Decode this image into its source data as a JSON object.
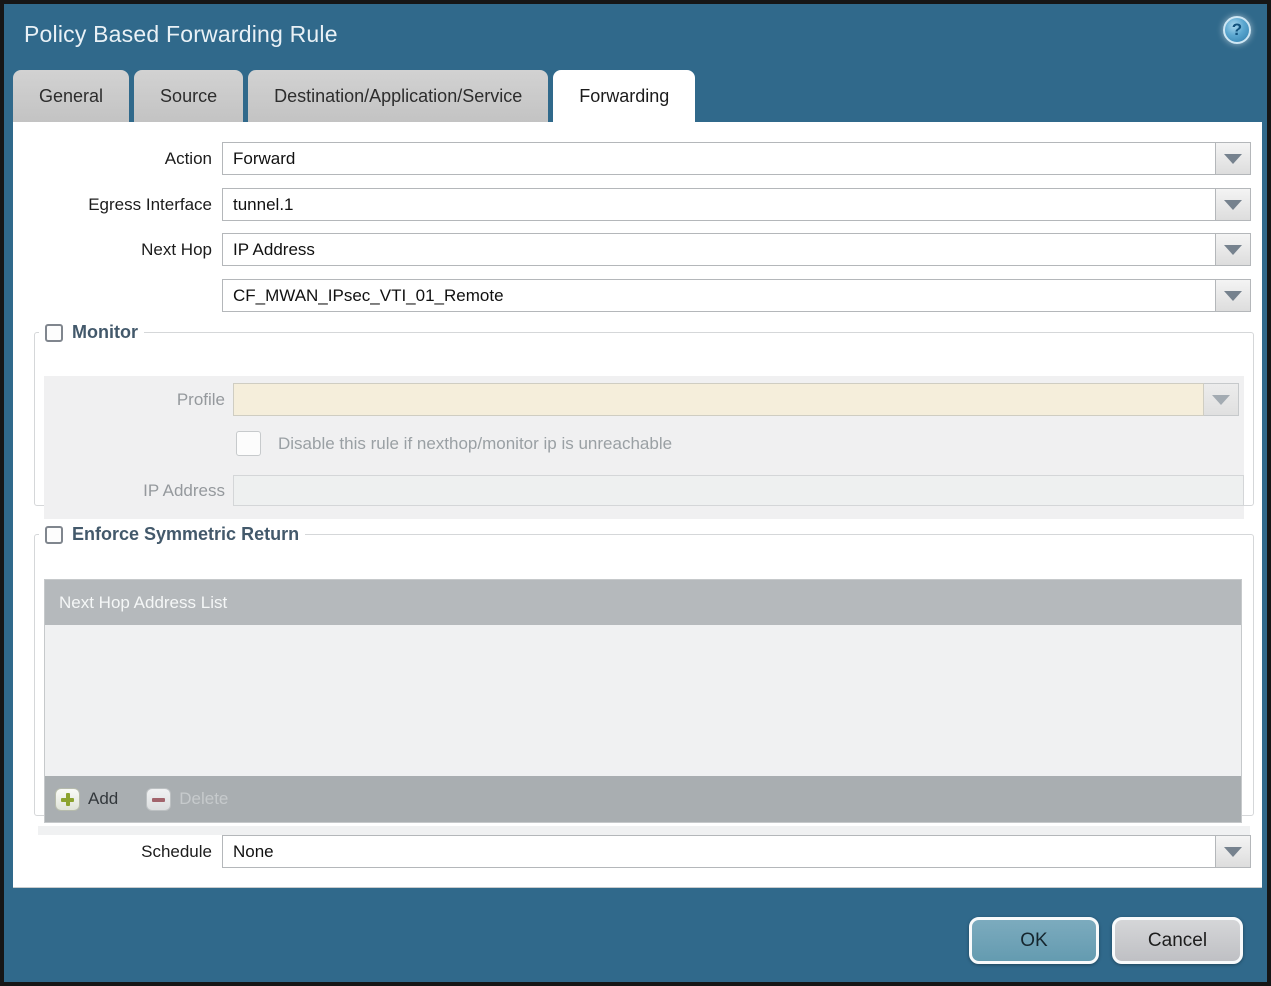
{
  "window": {
    "title": "Policy Based Forwarding Rule"
  },
  "icons": {
    "help_glyph": "?"
  },
  "tabs": [
    {
      "label": "General",
      "active": false
    },
    {
      "label": "Source",
      "active": false
    },
    {
      "label": "Destination/Application/Service",
      "active": false
    },
    {
      "label": "Forwarding",
      "active": true
    }
  ],
  "form": {
    "action": {
      "label": "Action",
      "value": "Forward"
    },
    "egress_interface": {
      "label": "Egress Interface",
      "value": "tunnel.1"
    },
    "next_hop": {
      "label": "Next Hop",
      "value": "IP Address"
    },
    "next_hop_address": {
      "value": "CF_MWAN_IPsec_VTI_01_Remote"
    },
    "schedule": {
      "label": "Schedule",
      "value": "None"
    }
  },
  "monitor": {
    "legend": "Monitor",
    "checked": false,
    "profile": {
      "label": "Profile",
      "value": ""
    },
    "disable_rule": {
      "label": "Disable this rule if nexthop/monitor ip is unreachable",
      "checked": false
    },
    "ip_address": {
      "label": "IP Address",
      "value": ""
    }
  },
  "enforce_symmetric_return": {
    "legend": "Enforce Symmetric Return",
    "checked": false,
    "list": {
      "header": "Next Hop Address List",
      "rows": []
    },
    "toolbar": {
      "add_label": "Add",
      "delete_label": "Delete",
      "delete_enabled": false
    }
  },
  "footer": {
    "ok_label": "OK",
    "cancel_label": "Cancel"
  },
  "colors": {
    "titlebar": "#30698b",
    "ok_button": "#6da2b7",
    "disabled_beige": "#f5eedb",
    "list_header_gray": "#b5b9bc"
  }
}
